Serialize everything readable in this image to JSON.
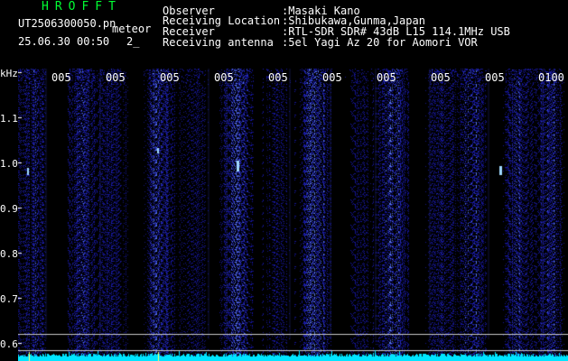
{
  "header": {
    "logo": "HROFFT",
    "filename": "UT2506300050.pn",
    "meteor_label": "meteor",
    "datetime": "25.06.30 00:50",
    "count": "2_",
    "rows": [
      {
        "label": "Observer",
        "value": ":Masaki Kano"
      },
      {
        "label": "Receiving Location",
        "value": ":Shibukawa,Gunma,Japan"
      },
      {
        "label": "Receiver",
        "value": ":RTL-SDR SDR# 43dB L15 114.1MHz USB"
      },
      {
        "label": "Receiving antenna",
        "value": ":5el Yagi Az 20 for Aomori VOR"
      }
    ]
  },
  "axis": {
    "y_unit": "kHz",
    "y_ticks": [
      "1.1",
      "1.0",
      "0.9",
      "0.8",
      "0.7",
      "0.6"
    ],
    "x_ticks": [
      "005",
      "005",
      "005",
      "005",
      "005",
      "005",
      "005",
      "005",
      "005",
      "0100"
    ]
  },
  "colors": {
    "background": "#000000",
    "noise": "#1a1aa8",
    "spectrum": "#00e5ff",
    "logo": "#00ff33",
    "text": "#ffffff"
  }
}
